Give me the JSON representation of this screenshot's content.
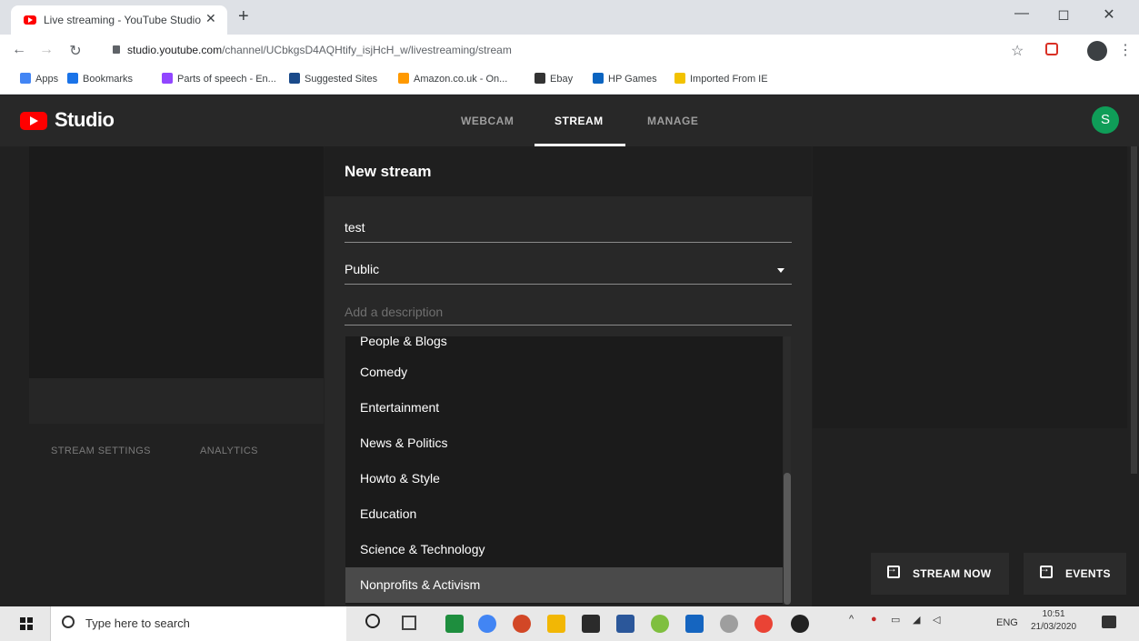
{
  "browser": {
    "tab_title": "Live streaming - YouTube Studio",
    "tab_close": "✕",
    "new_tab": "+",
    "url_host": "studio.youtube.com",
    "url_path": "/channel/UCbkgsD4AQHtify_isjHcH_w/livestreaming/stream",
    "window_controls": [
      "—",
      "◻",
      "✕"
    ]
  },
  "bookmarks": [
    {
      "label": "Apps",
      "color": "#4285f4"
    },
    {
      "label": "Bookmarks",
      "color": "#1a73e8"
    },
    {
      "label": "Parts of speech - En...",
      "color": "#9146ff"
    },
    {
      "label": "Suggested Sites",
      "color": "#1a4a8a"
    },
    {
      "label": "Amazon.co.uk - On...",
      "color": "#ff9900"
    },
    {
      "label": "Ebay",
      "color": "#333333"
    },
    {
      "label": "HP Games",
      "color": "#0b64c0"
    },
    {
      "label": "Imported From IE",
      "color": "#f2c200"
    }
  ],
  "studio": {
    "brand": "Studio",
    "nav": [
      {
        "label": "WEBCAM",
        "active": false
      },
      {
        "label": "STREAM",
        "active": true
      },
      {
        "label": "MANAGE",
        "active": false
      }
    ],
    "avatar_letter": "S"
  },
  "left_tabs": [
    "STREAM SETTINGS",
    "ANALYTICS"
  ],
  "dialog": {
    "title": "New stream",
    "name_value": "test",
    "visibility_value": "Public",
    "description_placeholder": "Add a description",
    "partial_option": "People & Blogs",
    "options": [
      "Comedy",
      "Entertainment",
      "News & Politics",
      "Howto & Style",
      "Education",
      "Science & Technology",
      "Nonprofits & Activism"
    ],
    "selected_option": "Nonprofits & Activism"
  },
  "buttons": {
    "stream_now": "STREAM NOW",
    "events": "EVENTS"
  },
  "taskbar": {
    "search_placeholder": "Type here to search",
    "lang": "ENG",
    "time": "10:51",
    "date": "21/03/2020"
  },
  "colors": {
    "accent_red": "#ff0000",
    "avatar_green": "#0f9d58",
    "bg_dark": "#212121"
  }
}
